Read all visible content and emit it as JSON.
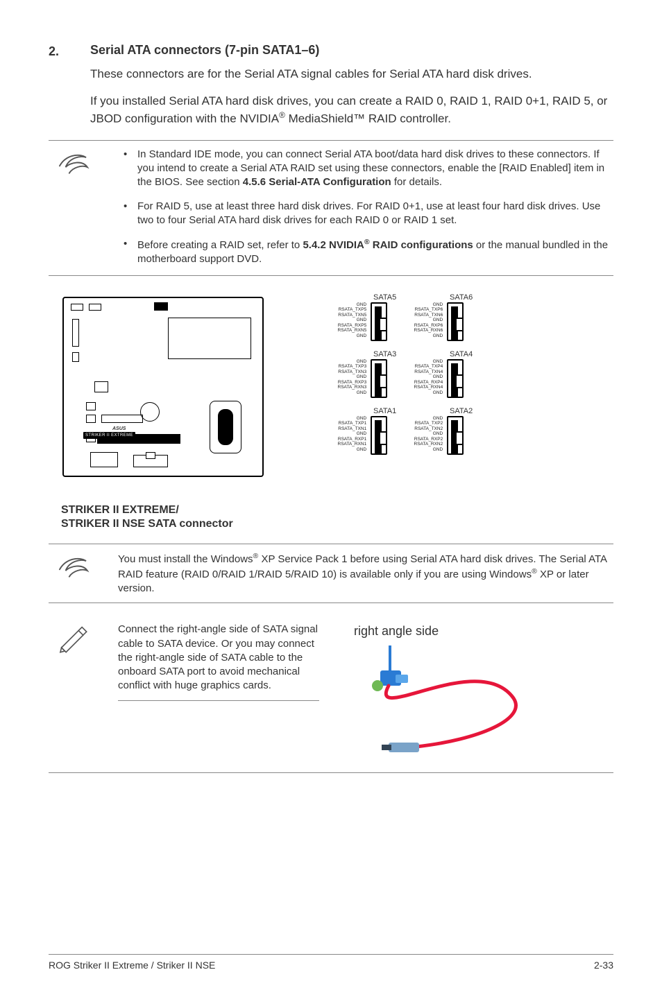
{
  "section": {
    "number": "2.",
    "title": "Serial ATA connectors (7-pin SATA1–6)",
    "para1": "These connectors are for the Serial ATA signal cables for Serial ATA hard disk drives.",
    "para2_pre": "If you installed Serial ATA hard disk drives, you can create a RAID 0, RAID 1, RAID 0+1, RAID 5, or JBOD configuration with the NVIDIA",
    "para2_post": " MediaShield™ RAID controller."
  },
  "note1": {
    "b1_pre": "In Standard IDE mode, you can connect Serial ATA boot/data hard disk drives to these connectors. If you intend to create a Serial ATA RAID set using these connectors, enable the [RAID Enabled] item in the BIOS. See section ",
    "b1_bold": "4.5.6 Serial-ATA Configuration",
    "b1_post": " for details.",
    "b2": "For RAID 5, use at least three hard disk drives. For RAID 0+1, use at least four hard disk drives. Use two to four Serial ATA hard disk drives for each RAID 0 or RAID 1 set.",
    "b3_pre": "Before creating a RAID set, refer to ",
    "b3_bold_a": "5.4.2 NVIDIA",
    "b3_bold_b": " RAID configurations",
    "b3_post": " or the manual bundled in the motherboard support DVD."
  },
  "diagram": {
    "board_label": "STRIKER II EXTREME",
    "caption_l1": "STRIKER II EXTREME/",
    "caption_l2": "STRIKER II NSE SATA connector",
    "rows": [
      {
        "left_title": "SATA5",
        "right_title": "SATA6",
        "left_pins": [
          "GND",
          "RSATA_TXP5",
          "RSATA_TXN5",
          "GND",
          "RSATA_RXP5",
          "RSATA_RXN5",
          "GND"
        ],
        "right_pins": [
          "GND",
          "RSATA_TXP6",
          "RSATA_TXN6",
          "GND",
          "RSATA_RXP6",
          "RSATA_RXN6",
          "GND"
        ]
      },
      {
        "left_title": "SATA3",
        "right_title": "SATA4",
        "left_pins": [
          "GND",
          "RSATA_TXP3",
          "RSATA_TXN3",
          "GND",
          "RSATA_RXP3",
          "RSATA_RXN3",
          "GND"
        ],
        "right_pins": [
          "GND",
          "RSATA_TXP4",
          "RSATA_TXN4",
          "GND",
          "RSATA_RXP4",
          "RSATA_RXN4",
          "GND"
        ]
      },
      {
        "left_title": "SATA1",
        "right_title": "SATA2",
        "left_pins": [
          "GND",
          "RSATA_TXP1",
          "RSATA_TXN1",
          "GND",
          "RSATA_RXP1",
          "RSATA_RXN1",
          "GND"
        ],
        "right_pins": [
          "GND",
          "RSATA_TXP2",
          "RSATA_TXN2",
          "GND",
          "RSATA_RXP2",
          "RSATA_RXN2",
          "GND"
        ]
      }
    ]
  },
  "note2": {
    "t_pre": "You must install the Windows",
    "t_mid1": " XP Service Pack 1 before using Serial ATA hard disk drives. The Serial ATA RAID feature (RAID 0/RAID 1/RAID 5/RAID 10) is available only if you are using Windows",
    "t_post": " XP or later version."
  },
  "tip": {
    "text": "Connect the right-angle side of SATA signal cable to SATA device. Or you may connect the right-angle side of SATA cable to the onboard SATA port to avoid mechanical conflict with huge graphics cards.",
    "cable_label": "right angle side"
  },
  "footer": {
    "left": "ROG Striker II Extreme / Striker II NSE",
    "right": "2-33"
  }
}
